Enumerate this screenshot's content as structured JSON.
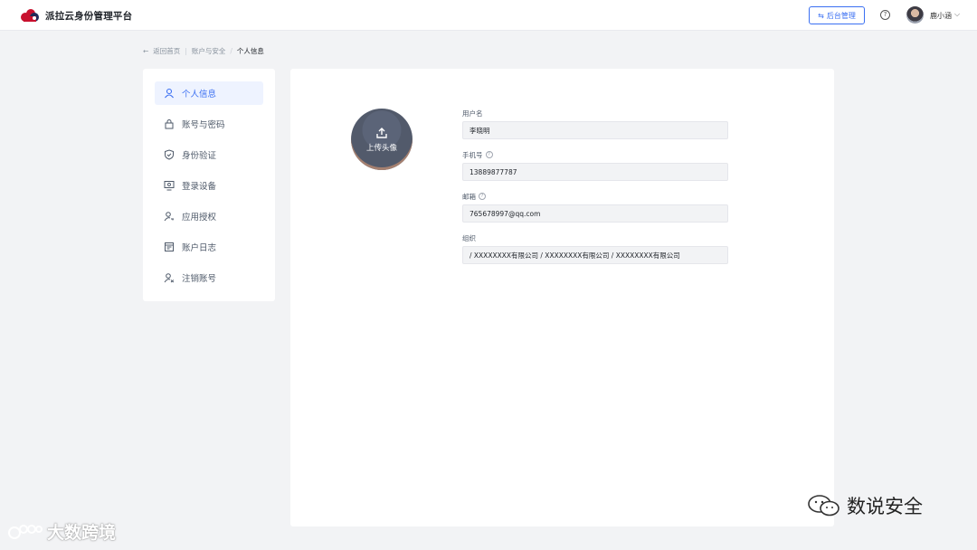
{
  "header": {
    "app_title": "派拉云身份管理平台",
    "admin_button_label": "后台管理",
    "help_icon": "question-circle-icon",
    "username": "鹿小涵",
    "brand_color": "#c8102e"
  },
  "breadcrumb": {
    "back_label": "返回首页",
    "section": "账户与安全",
    "current": "个人信息"
  },
  "sidebar": {
    "items": [
      {
        "label": "个人信息",
        "icon": "user-icon",
        "active": true
      },
      {
        "label": "账号与密码",
        "icon": "lock-icon",
        "active": false
      },
      {
        "label": "身份验证",
        "icon": "shield-check-icon",
        "active": false
      },
      {
        "label": "登录设备",
        "icon": "monitor-icon",
        "active": false
      },
      {
        "label": "应用授权",
        "icon": "user-key-icon",
        "active": false
      },
      {
        "label": "账户日志",
        "icon": "log-icon",
        "active": false
      },
      {
        "label": "注销账号",
        "icon": "user-remove-icon",
        "active": false
      }
    ]
  },
  "profile": {
    "upload_avatar_label": "上传头像",
    "fields": {
      "username_label": "用户名",
      "username_value": "李晓明",
      "phone_label": "手机号",
      "phone_value": "13889877787",
      "email_label": "邮箱",
      "email_value": "765678997@qq.com",
      "org_label": "组织",
      "org_value": "/ XXXXXXXX有限公司 / XXXXXXXX有限公司 / XXXXXXXX有限公司"
    }
  },
  "watermarks": {
    "left": "大数跨境",
    "right": "数说安全"
  },
  "colors": {
    "accent": "#3a6ff2",
    "active_bg": "#eef3ff"
  }
}
